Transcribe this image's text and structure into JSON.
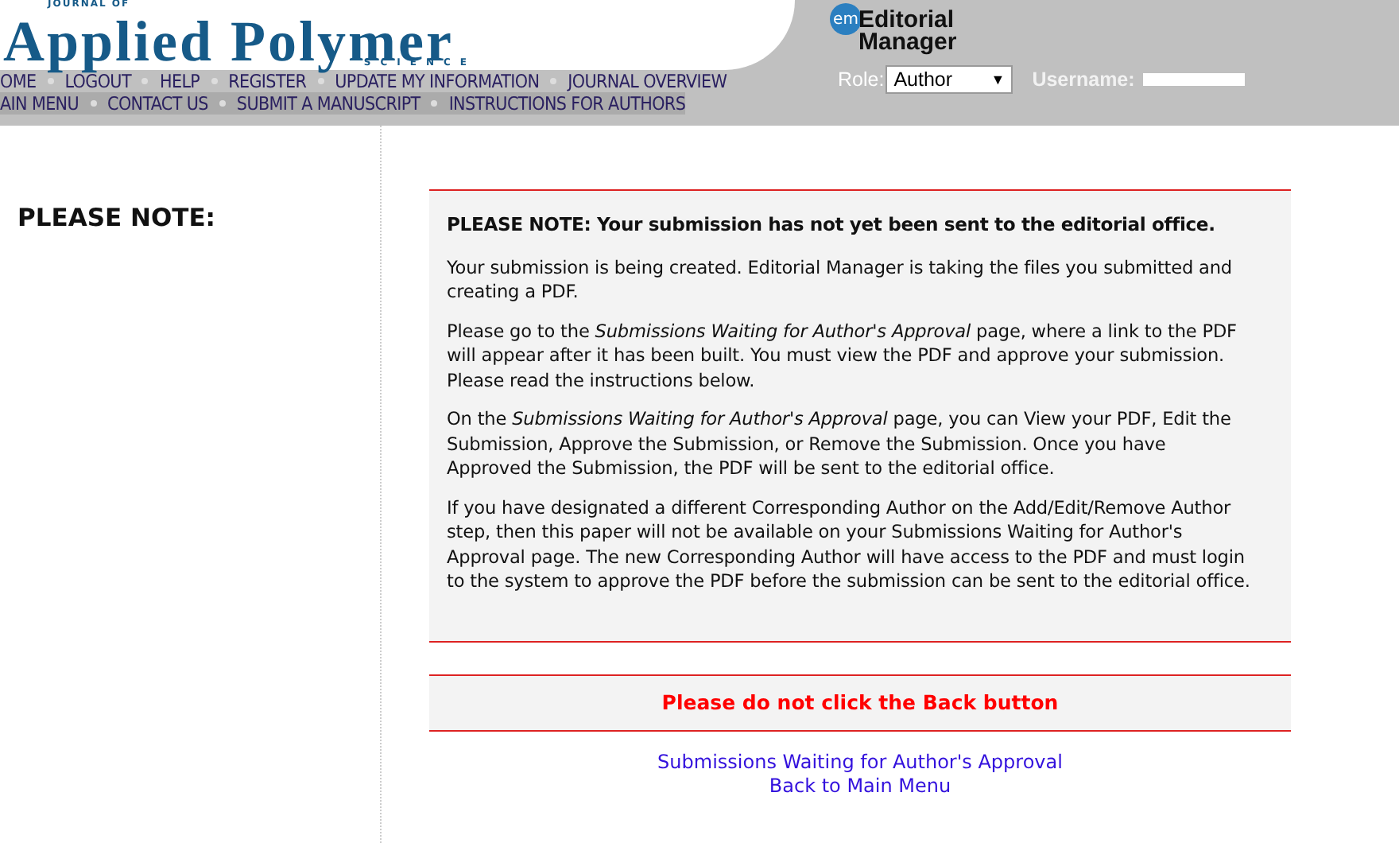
{
  "logo": {
    "top": "JOURNAL OF",
    "main": "Applied Polymer",
    "sub": "SCIENCE"
  },
  "brand": {
    "badge": "em",
    "line1": "Editorial",
    "line2": "Manager"
  },
  "nav_rows": [
    [
      "OME",
      "LOGOUT",
      "HELP",
      "REGISTER",
      "UPDATE MY INFORMATION",
      "JOURNAL OVERVIEW"
    ],
    [
      "AIN MENU",
      "CONTACT US",
      "SUBMIT A MANUSCRIPT",
      "INSTRUCTIONS FOR AUTHORS"
    ]
  ],
  "role": {
    "label": "Role:",
    "value": "Author",
    "arrow": "▼"
  },
  "username": {
    "label": "Username:"
  },
  "sidebar": {
    "heading": "PLEASE NOTE:"
  },
  "notice": {
    "heading": "PLEASE NOTE: Your submission has not yet been sent to the editorial office.",
    "paragraphs": [
      "Your submission is being created. Editorial Manager is taking the files you submitted and creating a PDF.",
      "Please go to the *Submissions Waiting for Author's Approval* page, where a link to the PDF will appear after it has been built. You must view the PDF and approve your submission. Please read the instructions below.",
      "On the *Submissions Waiting for Author's Approval* page, you can View your PDF, Edit the Submission, Approve the Submission, or Remove the Submission. Once you have Approved the Submission, the PDF will be sent to the editorial office.",
      "If you have designated a different Corresponding Author on the Add/Edit/Remove Author step, then this paper will not be available on your Submissions Waiting for Author's Approval page. The new Corresponding Author will have access to the PDF and must login to the system to approve the PDF before the submission can be sent to the editorial office."
    ]
  },
  "warning": "Please do not click the Back button",
  "links": [
    "Submissions Waiting for Author's Approval",
    "Back to Main Menu"
  ]
}
